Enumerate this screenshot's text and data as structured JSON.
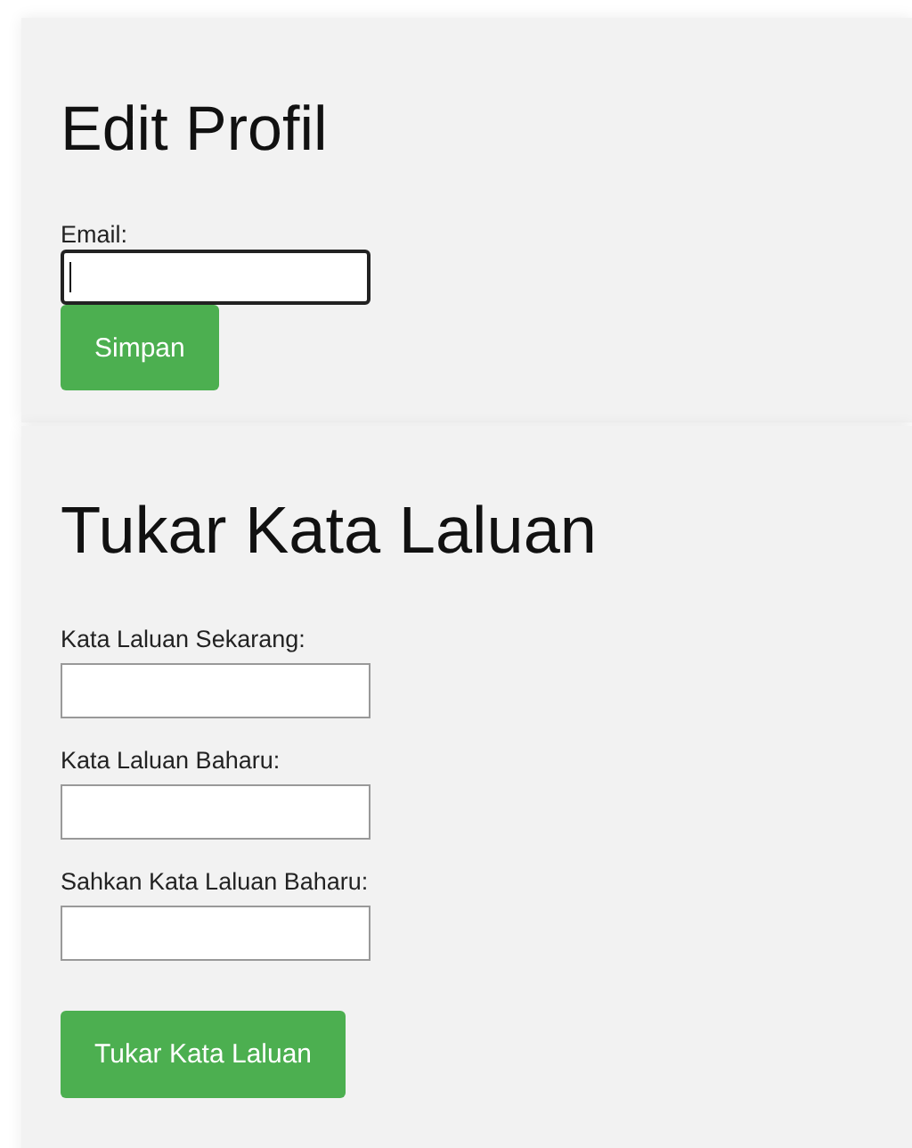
{
  "edit_profile": {
    "title": "Edit Profil",
    "fields": [
      {
        "label": "Email:",
        "focused": true
      }
    ],
    "button": "Simpan"
  },
  "change_password": {
    "title": "Tukar Kata Laluan",
    "fields": [
      {
        "label": "Kata Laluan Sekarang:",
        "focused": false
      },
      {
        "label": "Kata Laluan Baharu:",
        "focused": false
      },
      {
        "label": "Sahkan Kata Laluan Baharu:",
        "focused": false
      }
    ],
    "button": "Tukar Kata Laluan"
  }
}
